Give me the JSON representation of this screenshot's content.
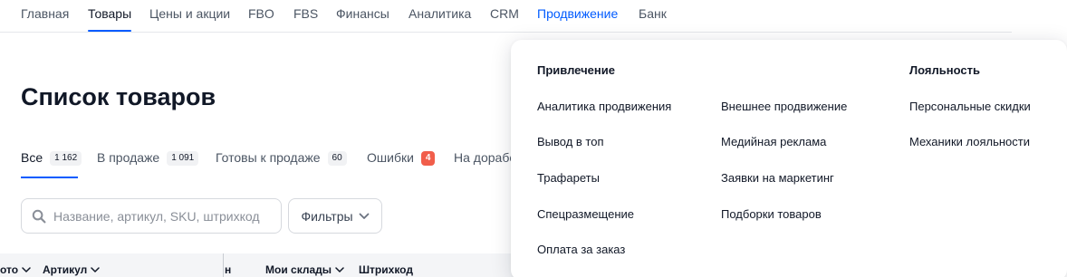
{
  "topnav": {
    "items": [
      {
        "label": "Главная"
      },
      {
        "label": "Товары"
      },
      {
        "label": "Цены и акции"
      },
      {
        "label": "FBO"
      },
      {
        "label": "FBS"
      },
      {
        "label": "Финансы"
      },
      {
        "label": "Аналитика"
      },
      {
        "label": "CRM"
      },
      {
        "label": "Продвижение"
      },
      {
        "label": "Банк"
      }
    ],
    "active": "Товары",
    "highlighted": "Продвижение"
  },
  "page": {
    "title": "Список товаров"
  },
  "status_tabs": [
    {
      "label": "Все",
      "count": "1 162"
    },
    {
      "label": "В продаже",
      "count": "1 091"
    },
    {
      "label": "Готовы к продаже",
      "count": "60"
    },
    {
      "label": "Ошибки",
      "count": "4"
    },
    {
      "label": "На дорабо"
    }
  ],
  "search": {
    "placeholder": "Название, артикул, SKU, штрихкод",
    "value": ""
  },
  "filters": {
    "label": "Фильтры"
  },
  "table": {
    "columns": [
      "ото",
      "Артикул",
      "н",
      "Мои склады",
      "Штрихкод"
    ]
  },
  "promo_menu": {
    "groups": {
      "attraction": {
        "heading": "Привлечение"
      },
      "loyalty": {
        "heading": "Лояльность"
      }
    },
    "col1": [
      "Аналитика продвижения",
      "Вывод в топ",
      "Трафареты",
      "Спецразмещение",
      "Оплата за заказ"
    ],
    "col2": [
      "Внешнее продвижение",
      "Медийная реклама",
      "Заявки на маркетинг",
      "Подборки товаров"
    ],
    "col3": [
      "Персональные скидки",
      "Механики лояльности"
    ]
  },
  "colors": {
    "accent": "#005bff",
    "danger_badge": "#f15e4b",
    "text": "#111827",
    "muted": "#4b5563"
  }
}
